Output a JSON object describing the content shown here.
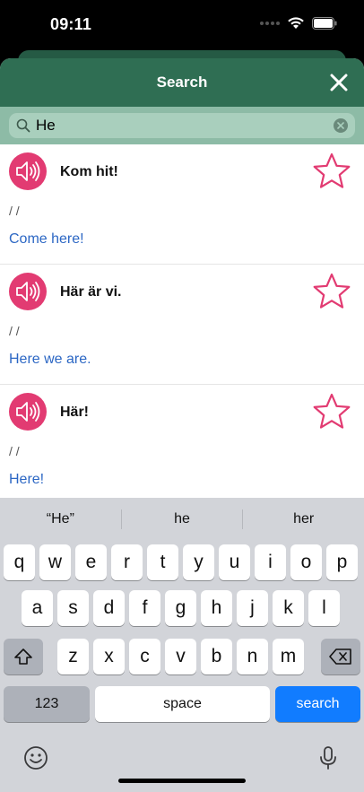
{
  "status": {
    "time": "09:11"
  },
  "header": {
    "title": "Search"
  },
  "search": {
    "value": "He",
    "placeholder": ""
  },
  "results": [
    {
      "title": "Kom hit!",
      "phonetic": "/ /",
      "translation": "Come here!"
    },
    {
      "title": "Här är vi.",
      "phonetic": "/ /",
      "translation": "Here we are."
    },
    {
      "title": "Här!",
      "phonetic": "/ /",
      "translation": "Here!"
    }
  ],
  "keyboard": {
    "suggestions": [
      "“He”",
      "he",
      "her"
    ],
    "row1": [
      "q",
      "w",
      "e",
      "r",
      "t",
      "y",
      "u",
      "i",
      "o",
      "p"
    ],
    "row2": [
      "a",
      "s",
      "d",
      "f",
      "g",
      "h",
      "j",
      "k",
      "l"
    ],
    "row3": [
      "z",
      "x",
      "c",
      "v",
      "b",
      "n",
      "m"
    ],
    "numbers_label": "123",
    "space_label": "space",
    "return_label": "search"
  },
  "colors": {
    "nav": "#2f6e53",
    "accent": "#e23b72",
    "link": "#2c67c4",
    "key_blue": "#117cff"
  }
}
